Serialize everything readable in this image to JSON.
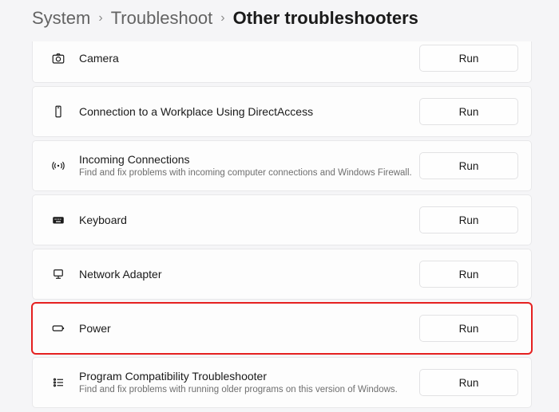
{
  "breadcrumb": {
    "level1": "System",
    "level2": "Troubleshoot",
    "current": "Other troubleshooters"
  },
  "run_label": "Run",
  "items": [
    {
      "id": "camera",
      "title": "Camera",
      "desc": ""
    },
    {
      "id": "directaccess",
      "title": "Connection to a Workplace Using DirectAccess",
      "desc": ""
    },
    {
      "id": "incoming",
      "title": "Incoming Connections",
      "desc": "Find and fix problems with incoming computer connections and Windows Firewall."
    },
    {
      "id": "keyboard",
      "title": "Keyboard",
      "desc": ""
    },
    {
      "id": "netadapter",
      "title": "Network Adapter",
      "desc": ""
    },
    {
      "id": "power",
      "title": "Power",
      "desc": ""
    },
    {
      "id": "compat",
      "title": "Program Compatibility Troubleshooter",
      "desc": "Find and fix problems with running older programs on this version of Windows."
    }
  ],
  "highlighted_id": "power"
}
